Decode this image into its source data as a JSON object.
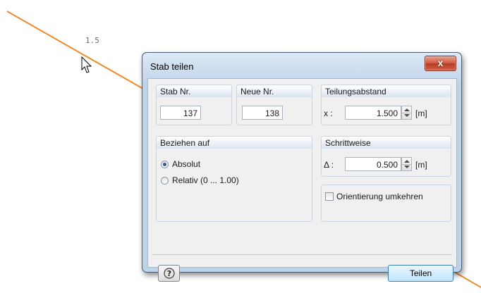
{
  "canvas": {
    "dimension_label": "1.5",
    "member_line_color": "#f08a28"
  },
  "dialog": {
    "title": "Stab teilen",
    "close_glyph": "x",
    "stab_nr": {
      "label": "Stab Nr.",
      "value": "137"
    },
    "neue_nr": {
      "label": "Neue Nr.",
      "value": "138"
    },
    "teilungsabstand": {
      "label": "Teilungsabstand",
      "axis_label": "x :",
      "value": "1.500",
      "unit": "[m]"
    },
    "beziehen_auf": {
      "label": "Beziehen auf",
      "options": [
        {
          "label": "Absolut",
          "selected": true
        },
        {
          "label": "Relativ (0 ... 1.00)",
          "selected": false
        }
      ]
    },
    "schrittweise": {
      "label": "Schrittweise",
      "axis_label": "Δ :",
      "value": "0.500",
      "unit": "[m]"
    },
    "orientierung": {
      "label": "Orientierung umkehren",
      "checked": false
    },
    "help_icon": "help-icon",
    "ok_button": "Teilen"
  }
}
